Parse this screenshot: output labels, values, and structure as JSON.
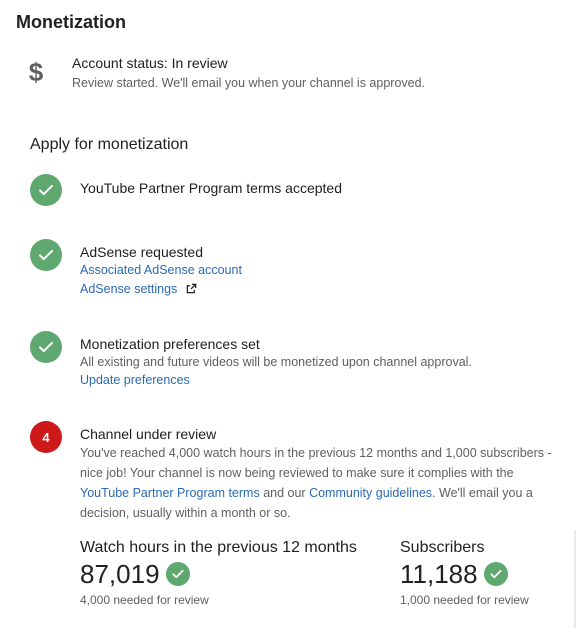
{
  "page": {
    "title": "Monetization"
  },
  "account": {
    "icon": "dollar-icon",
    "icon_glyph": "$",
    "status": "Account status: In review",
    "description": "Review started. We'll email you when your channel is approved."
  },
  "apply": {
    "title": "Apply for monetization",
    "steps": [
      {
        "state": "done",
        "title": "YouTube Partner Program terms accepted"
      },
      {
        "state": "done",
        "title": "AdSense requested",
        "links": [
          "Associated AdSense account",
          "AdSense settings"
        ]
      },
      {
        "state": "done",
        "title": "Monetization preferences set",
        "text": "All existing and future videos will be monetized upon channel approval.",
        "links": [
          "Update preferences"
        ]
      },
      {
        "state": "number",
        "number": "4",
        "title": "Channel under review",
        "text_before": "You've reached 4,000 watch hours in the previous 12 months and 1,000 subscribers - nice job! Your channel is now being reviewed to make sure it complies with the ",
        "link_terms": "YouTube Partner Program terms",
        "text_middle": " and our ",
        "link_guidelines": "Community guidelines",
        "text_after": ". We'll email you a decision, usually within a month or so."
      }
    ]
  },
  "stats": {
    "watch_hours": {
      "label": "Watch hours in the previous 12 months",
      "value": "87,019",
      "needed": "4,000 needed for review"
    },
    "subscribers": {
      "label": "Subscribers",
      "value": "11,188",
      "needed": "1,000 needed for review"
    }
  },
  "colors": {
    "check_green": "#5fa86f",
    "step_red": "#cc1a1a",
    "link_blue": "#2a6ab5"
  }
}
